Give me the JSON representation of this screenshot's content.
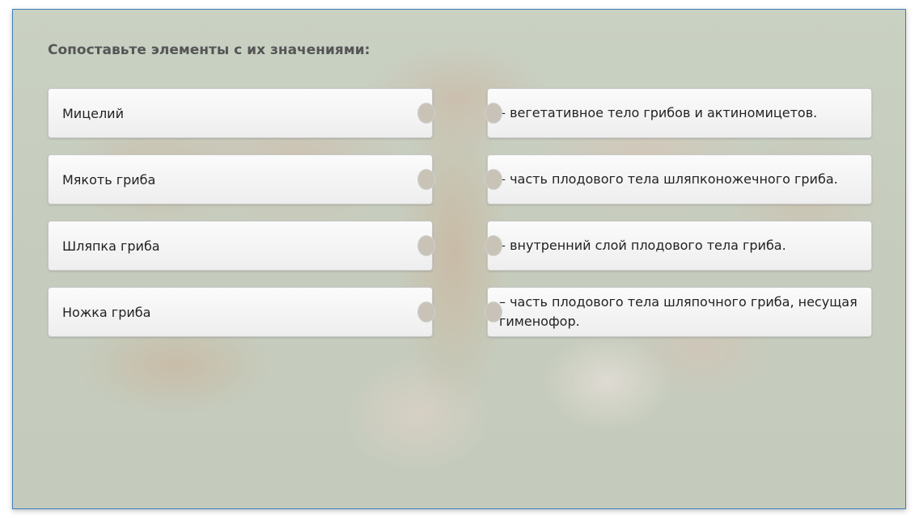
{
  "question": "Сопоставьте элементы с их значениями:",
  "terms": [
    "Мицелий",
    "Мякоть гриба",
    "Шляпка гриба",
    "Ножка гриба"
  ],
  "definitions": [
    "– вегетативное тело грибов и актиномицетов.",
    "– часть плодового тела шляпконожечного гриба.",
    "– внутренний слой плодового тела гриба.",
    "– часть плодового тела шляпочного гриба, несущая гименофор."
  ]
}
